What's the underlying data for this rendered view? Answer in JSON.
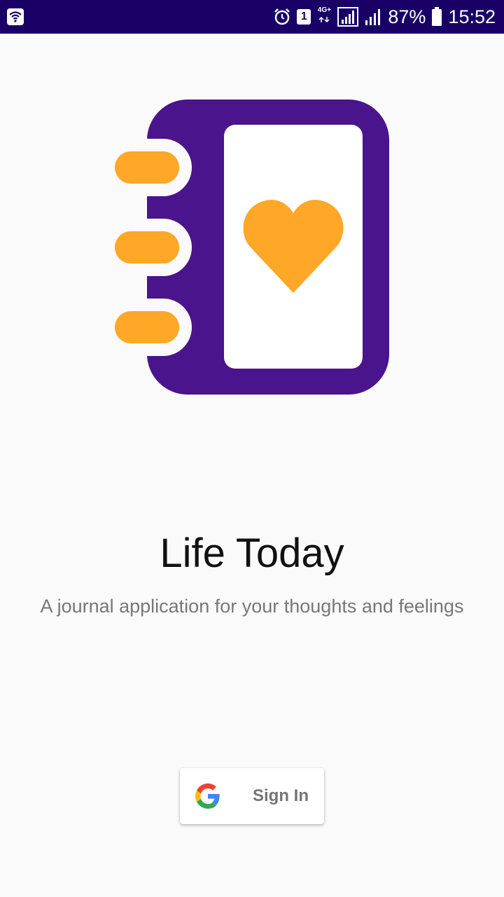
{
  "status_bar": {
    "sim_slot": "1",
    "network_type": "4G+",
    "battery_percent": "87%",
    "time": "15:52",
    "icons": [
      "wifi-icon",
      "alarm-icon",
      "sim-badge",
      "network-icon",
      "signal-icon",
      "signal-icon",
      "battery-icon"
    ]
  },
  "app": {
    "title": "Life Today",
    "subtitle": "A journal application for your thoughts and feelings",
    "logo_icon": "journal-heart-icon"
  },
  "signin": {
    "label": "Sign In",
    "icon": "google-icon"
  },
  "colors": {
    "status_bar": "#1a0066",
    "brand_purple": "#4a148c",
    "accent_orange": "#ffa726",
    "background": "#fafafa"
  }
}
